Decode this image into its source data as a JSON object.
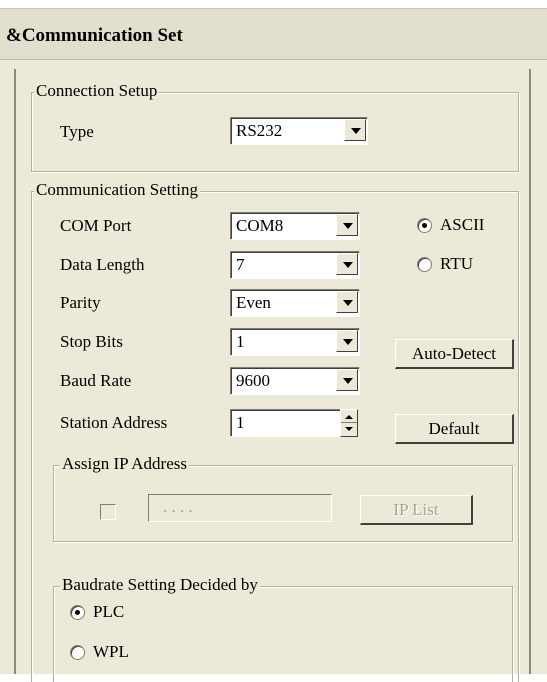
{
  "window": {
    "title": "&Communication Set"
  },
  "connection_setup": {
    "legend": "Connection Setup",
    "type_label": "Type",
    "type_value": "RS232"
  },
  "communication_setting": {
    "legend": "Communication Setting",
    "com_port": {
      "label": "COM Port",
      "value": "COM8"
    },
    "data_length": {
      "label": "Data Length",
      "value": "7"
    },
    "parity": {
      "label": "Parity",
      "value": "Even"
    },
    "stop_bits": {
      "label": "Stop Bits",
      "value": "1"
    },
    "baud_rate": {
      "label": "Baud Rate",
      "value": "9600"
    },
    "station_address": {
      "label": "Station Address",
      "value": "1"
    },
    "mode": {
      "ascii_label": "ASCII",
      "rtu_label": "RTU",
      "selected": "ASCII"
    },
    "auto_detect_label": "Auto-Detect",
    "default_label": "Default"
  },
  "assign_ip": {
    "legend": "Assign IP Address",
    "checked": false,
    "ip_placeholder": ". . . .",
    "ip_list_label": "IP List"
  },
  "baudrate_setting": {
    "legend": "Baudrate Setting Decided by",
    "plc_label": "PLC",
    "wpl_label": "WPL",
    "selected": "PLC"
  }
}
